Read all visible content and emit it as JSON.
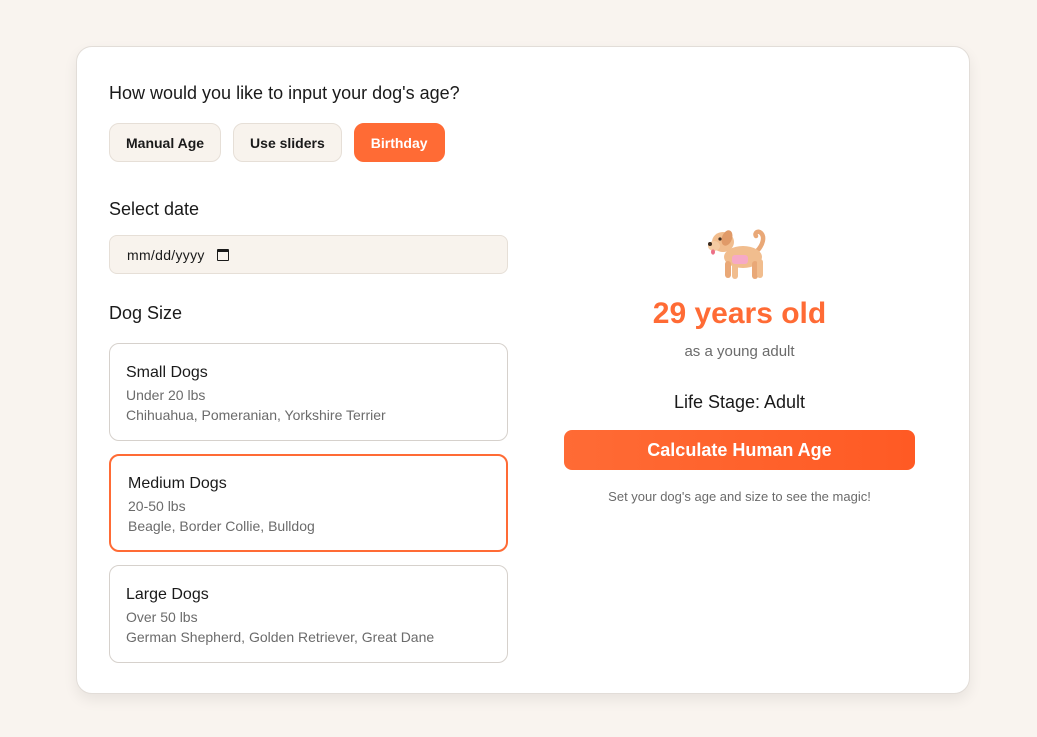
{
  "prompt": "How would you like to input your dog's age?",
  "modes": [
    {
      "label": "Manual Age",
      "active": false
    },
    {
      "label": "Use sliders",
      "active": false
    },
    {
      "label": "Birthday",
      "active": true
    }
  ],
  "date_section": {
    "title": "Select date",
    "placeholder": "mm/dd/yyyy"
  },
  "size_section": {
    "title": "Dog Size",
    "options": [
      {
        "name": "Small Dogs",
        "weight": "Under 20 lbs",
        "breeds": "Chihuahua, Pomeranian, Yorkshire Terrier",
        "selected": false
      },
      {
        "name": "Medium Dogs",
        "weight": "20-50 lbs",
        "breeds": "Beagle, Border Collie, Bulldog",
        "selected": true
      },
      {
        "name": "Large Dogs",
        "weight": "Over 50 lbs",
        "breeds": "German Shepherd, Golden Retriever, Great Dane",
        "selected": false
      }
    ]
  },
  "result": {
    "icon": "dog-icon",
    "age": "29 years old",
    "description": "as a young adult",
    "life_stage": "Life Stage: Adult",
    "button_label": "Calculate Human Age",
    "hint": "Set your dog's age and size to see the magic!"
  },
  "colors": {
    "accent": "#ff6b35",
    "background": "#f9f4ef"
  }
}
